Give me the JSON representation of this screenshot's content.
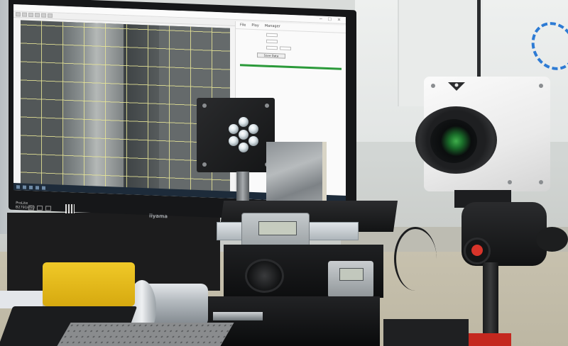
{
  "monitor": {
    "model": "ProLite\nB2791HSU",
    "brand": "iiyama",
    "window": {
      "title": "",
      "panel_tabs": [
        "File",
        "Play",
        "Manager"
      ],
      "panel_button": "Save Data"
    }
  },
  "caliper": {
    "display": "",
    "display2": ""
  },
  "colors": {
    "grid_line": "#e6e496",
    "progress": "#2b9a3a",
    "led": "#dfe8ec",
    "tripod_mark": "#d8342a"
  }
}
